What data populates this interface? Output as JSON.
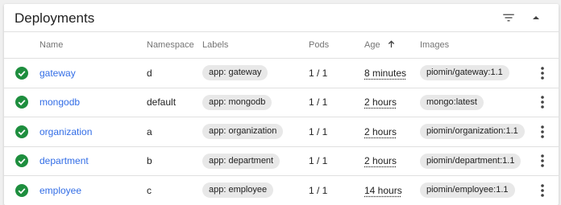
{
  "card": {
    "title": "Deployments",
    "filter_icon": "filter-list-icon",
    "collapse_icon": "expand-less-icon"
  },
  "table": {
    "columns": {
      "name": "Name",
      "namespace": "Namespace",
      "labels": "Labels",
      "pods": "Pods",
      "age": "Age",
      "images": "Images"
    },
    "sort_indicator_icon": "arrow-upward-icon",
    "status_icon": "check-circle-icon",
    "status_color": "#1e8e3e",
    "link_color": "#326de6",
    "row_menu_icon": "more-vert-icon",
    "rows": [
      {
        "name": "gateway",
        "namespace": "d",
        "label": "app: gateway",
        "pods": "1 / 1",
        "age": "8 minutes",
        "image": "piomin/gateway:1.1"
      },
      {
        "name": "mongodb",
        "namespace": "default",
        "label": "app: mongodb",
        "pods": "1 / 1",
        "age": "2 hours",
        "image": "mongo:latest"
      },
      {
        "name": "organization",
        "namespace": "a",
        "label": "app: organization",
        "pods": "1 / 1",
        "age": "2 hours",
        "image": "piomin/organization:1.1"
      },
      {
        "name": "department",
        "namespace": "b",
        "label": "app: department",
        "pods": "1 / 1",
        "age": "2 hours",
        "image": "piomin/department:1.1"
      },
      {
        "name": "employee",
        "namespace": "c",
        "label": "app: employee",
        "pods": "1 / 1",
        "age": "14 hours",
        "image": "piomin/employee:1.1"
      }
    ]
  }
}
